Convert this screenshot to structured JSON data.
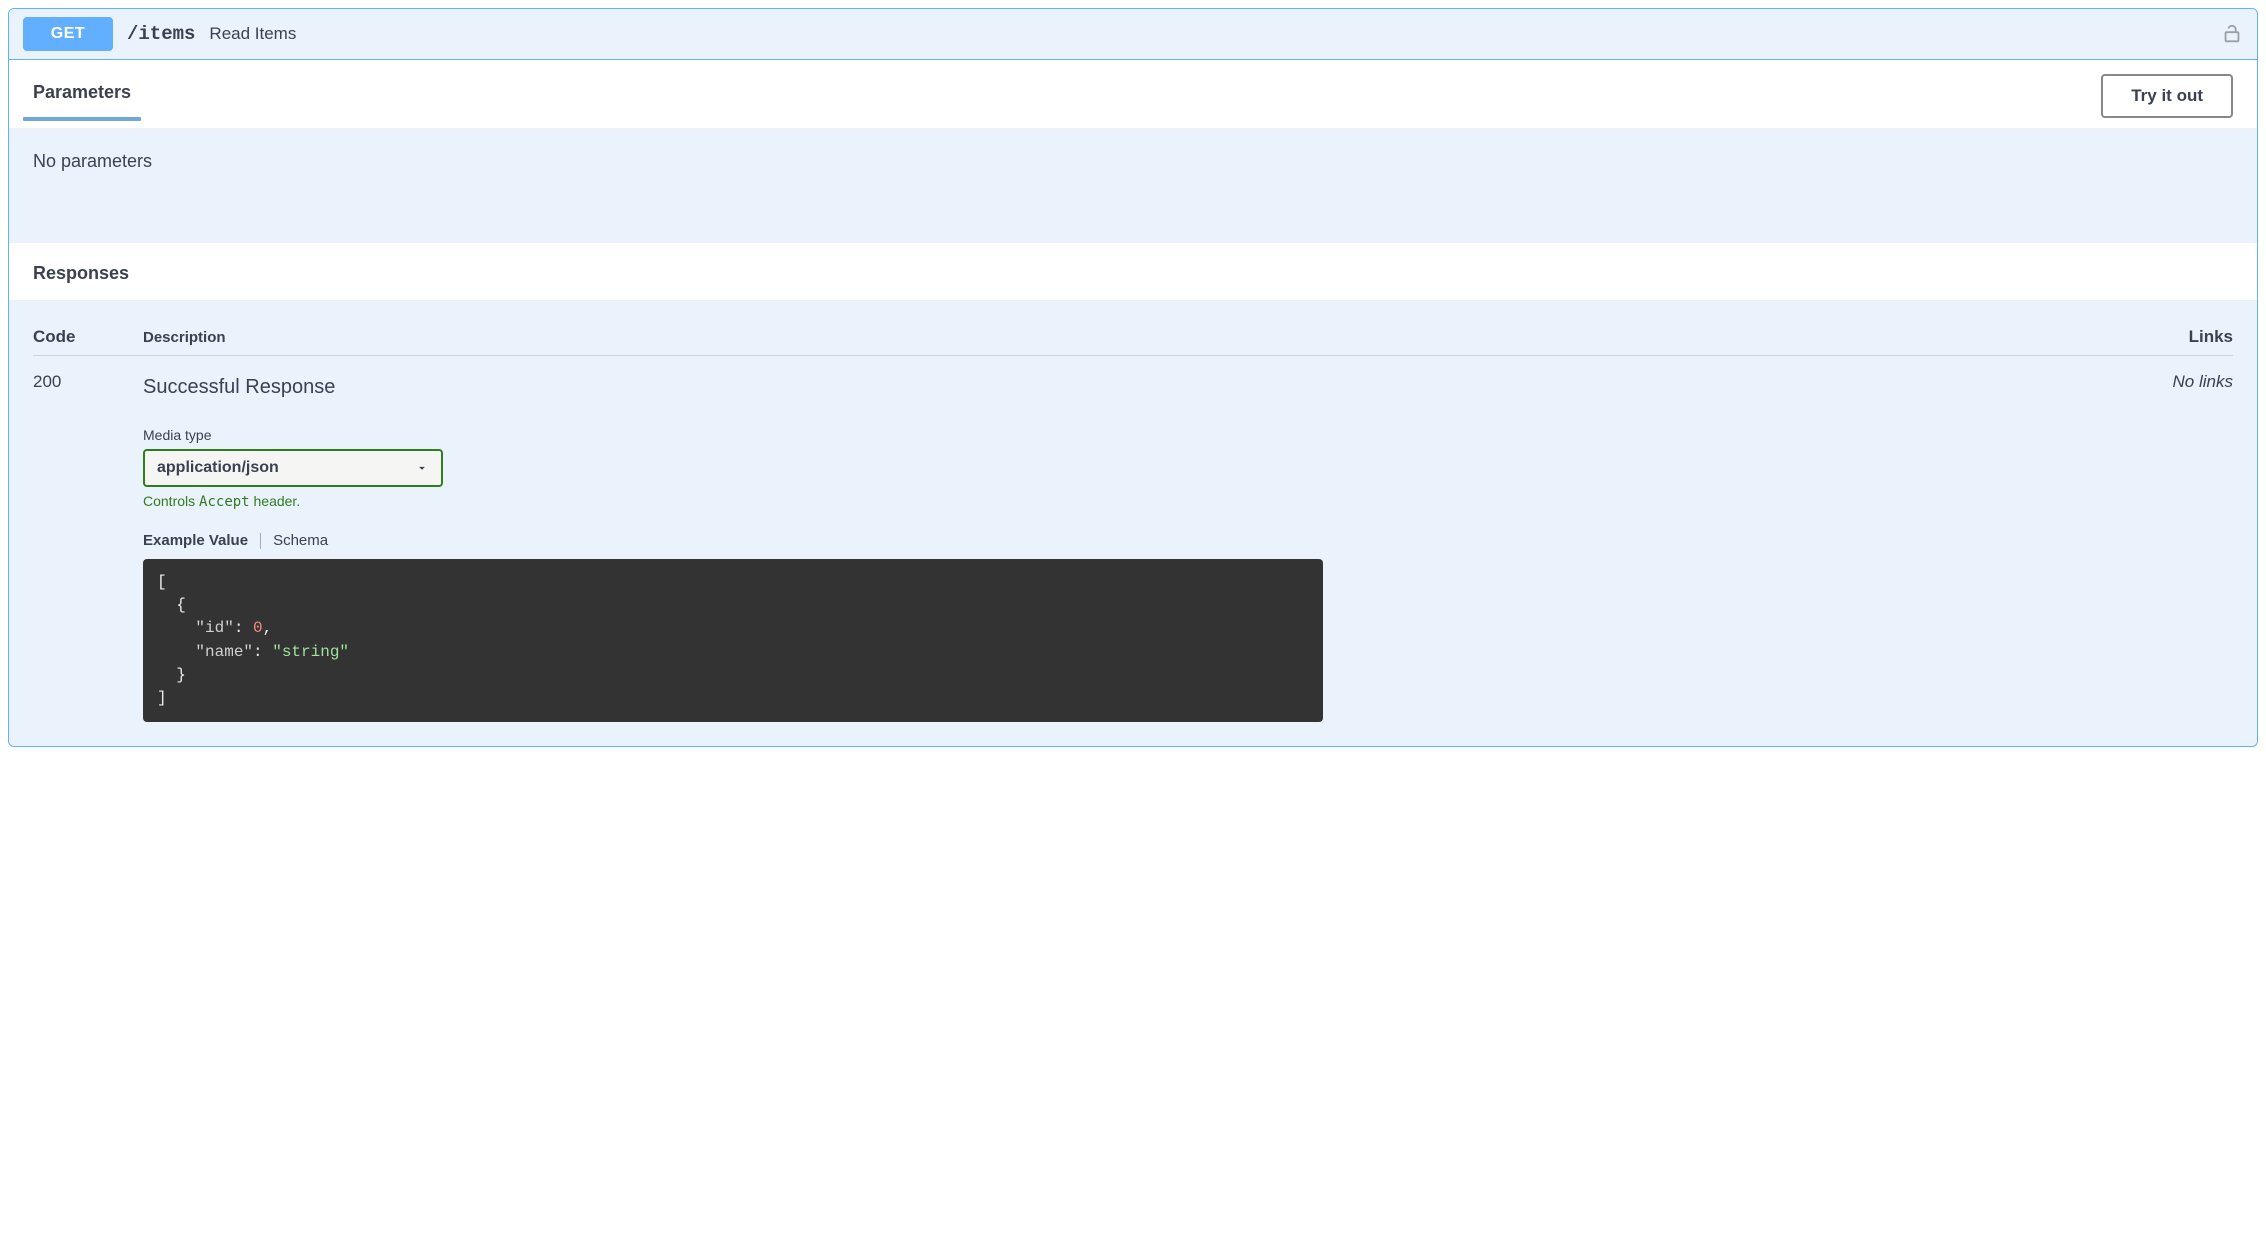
{
  "operation": {
    "method": "GET",
    "path": "/items",
    "summary": "Read Items",
    "authorized": false
  },
  "parameters": {
    "title": "Parameters",
    "try_label": "Try it out",
    "empty_message": "No parameters"
  },
  "responses": {
    "title": "Responses",
    "headers": {
      "code": "Code",
      "description": "Description",
      "links": "Links"
    },
    "rows": [
      {
        "code": "200",
        "description": "Successful Response",
        "links": "No links",
        "media_type_label": "Media type",
        "media_type_value": "application/json",
        "accept_hint_prefix": "Controls ",
        "accept_hint_code": "Accept",
        "accept_hint_suffix": " header.",
        "tabs": {
          "example": "Example Value",
          "schema": "Schema"
        },
        "example_tokens": [
          {
            "t": "punct",
            "v": "["
          },
          {
            "t": "nl"
          },
          {
            "t": "indent",
            "n": 1
          },
          {
            "t": "punct",
            "v": "{"
          },
          {
            "t": "nl"
          },
          {
            "t": "indent",
            "n": 2
          },
          {
            "t": "key",
            "v": "\"id\""
          },
          {
            "t": "punct",
            "v": ": "
          },
          {
            "t": "num",
            "v": "0"
          },
          {
            "t": "punct",
            "v": ","
          },
          {
            "t": "nl"
          },
          {
            "t": "indent",
            "n": 2
          },
          {
            "t": "key",
            "v": "\"name\""
          },
          {
            "t": "punct",
            "v": ": "
          },
          {
            "t": "str",
            "v": "\"string\""
          },
          {
            "t": "nl"
          },
          {
            "t": "indent",
            "n": 1
          },
          {
            "t": "punct",
            "v": "}"
          },
          {
            "t": "nl"
          },
          {
            "t": "punct",
            "v": "]"
          }
        ]
      }
    ]
  }
}
